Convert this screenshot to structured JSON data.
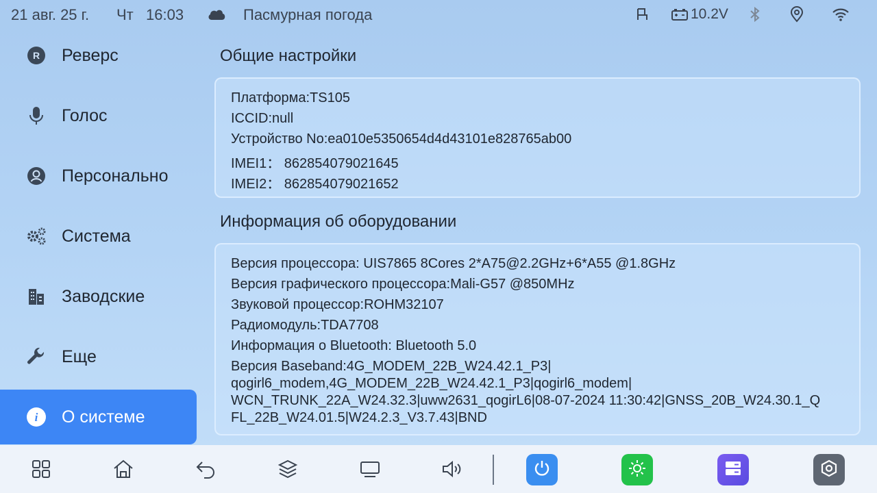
{
  "statusbar": {
    "date": "21 авг. 25 г.",
    "weekday": "Чт",
    "time": "16:03",
    "weather_icon": "cloud-icon",
    "weather": "Пасмурная погода",
    "voltage": "10.2V"
  },
  "sidebar": {
    "items": [
      {
        "label": "Реверс",
        "icon": "reverse-r-icon"
      },
      {
        "label": "Голос",
        "icon": "microphone-icon"
      },
      {
        "label": "Персонально",
        "icon": "person-icon"
      },
      {
        "label": "Система",
        "icon": "gears-icon"
      },
      {
        "label": "Заводские",
        "icon": "factory-icon"
      },
      {
        "label": "Еще",
        "icon": "wrench-icon"
      },
      {
        "label": "О системе",
        "icon": "info-icon",
        "active": true
      }
    ]
  },
  "general": {
    "title": "Общие настройки",
    "lines": [
      "Платформа:TS105",
      "ICCID:null",
      "Устройство No:ea010e5350654d4d43101e828765ab00",
      "IMEI1：  862854079021645",
      "IMEI2：  862854079021652"
    ]
  },
  "hardware": {
    "title": "Информация об оборудовании",
    "lines": [
      "Версия процессора: UIS7865 8Cores 2*A75@2.2GHz+6*A55 @1.8GHz",
      "Версия графического процессора:Mali-G57 @850MHz",
      "Звуковой процессор:ROHM32107",
      "Радиомодуль:TDA7708",
      "Информация о Bluetooth: Bluetooth 5.0",
      "Версия Baseband:4G_MODEM_22B_W24.42.1_P3|",
      "qogirl6_modem,4G_MODEM_22B_W24.42.1_P3|qogirl6_modem|",
      "WCN_TRUNK_22A_W24.32.3|uww2631_qogirL6|08-07-2024 11:30:42|GNSS_20B_W24.30.1_Q",
      "FL_22B_W24.01.5|W24.2.3_V3.7.43|BND"
    ]
  },
  "colors": {
    "accent": "#3d86f5",
    "power_app": "#3a8ef0",
    "brightness_app": "#23c24a",
    "storage_app": "#6a55e8",
    "settings_app": "#5e6672"
  }
}
